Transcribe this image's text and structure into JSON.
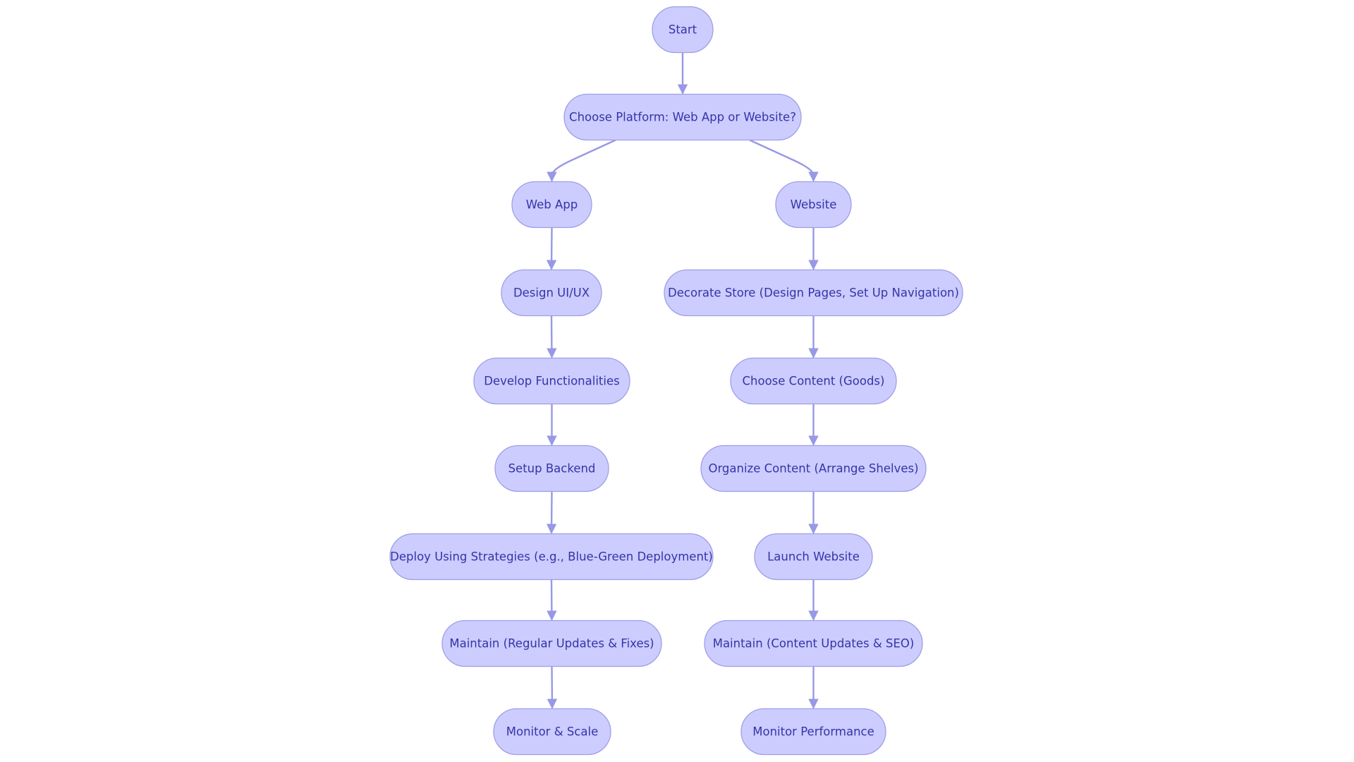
{
  "diagram": {
    "type": "flowchart",
    "colors": {
      "node_fill": "#ccccff",
      "node_stroke": "#9f9fe6",
      "text": "#3434a8",
      "edge": "#9898e6"
    },
    "nodes": [
      {
        "id": "start",
        "label": "Start"
      },
      {
        "id": "choose",
        "label": "Choose Platform: Web App or Website?"
      },
      {
        "id": "webapp",
        "label": "Web App"
      },
      {
        "id": "website",
        "label": "Website"
      },
      {
        "id": "design",
        "label": "Design UI/UX"
      },
      {
        "id": "decorate",
        "label": "Decorate Store (Design Pages, Set Up Navigation)"
      },
      {
        "id": "develop",
        "label": "Develop Functionalities"
      },
      {
        "id": "content",
        "label": "Choose Content (Goods)"
      },
      {
        "id": "backend",
        "label": "Setup Backend"
      },
      {
        "id": "organize",
        "label": "Organize Content (Arrange Shelves)"
      },
      {
        "id": "deploy",
        "label": "Deploy Using Strategies (e.g., Blue-Green Deployment)"
      },
      {
        "id": "launch",
        "label": "Launch Website"
      },
      {
        "id": "maintainL",
        "label": "Maintain (Regular Updates & Fixes)"
      },
      {
        "id": "maintainR",
        "label": "Maintain (Content Updates & SEO)"
      },
      {
        "id": "monitorL",
        "label": "Monitor & Scale"
      },
      {
        "id": "monitorR",
        "label": "Monitor Performance"
      }
    ],
    "edges": [
      [
        "start",
        "choose"
      ],
      [
        "choose",
        "webapp"
      ],
      [
        "choose",
        "website"
      ],
      [
        "webapp",
        "design"
      ],
      [
        "design",
        "develop"
      ],
      [
        "develop",
        "backend"
      ],
      [
        "backend",
        "deploy"
      ],
      [
        "deploy",
        "maintainL"
      ],
      [
        "maintainL",
        "monitorL"
      ],
      [
        "website",
        "decorate"
      ],
      [
        "decorate",
        "content"
      ],
      [
        "content",
        "organize"
      ],
      [
        "organize",
        "launch"
      ],
      [
        "launch",
        "maintainR"
      ],
      [
        "maintainR",
        "monitorR"
      ]
    ]
  }
}
